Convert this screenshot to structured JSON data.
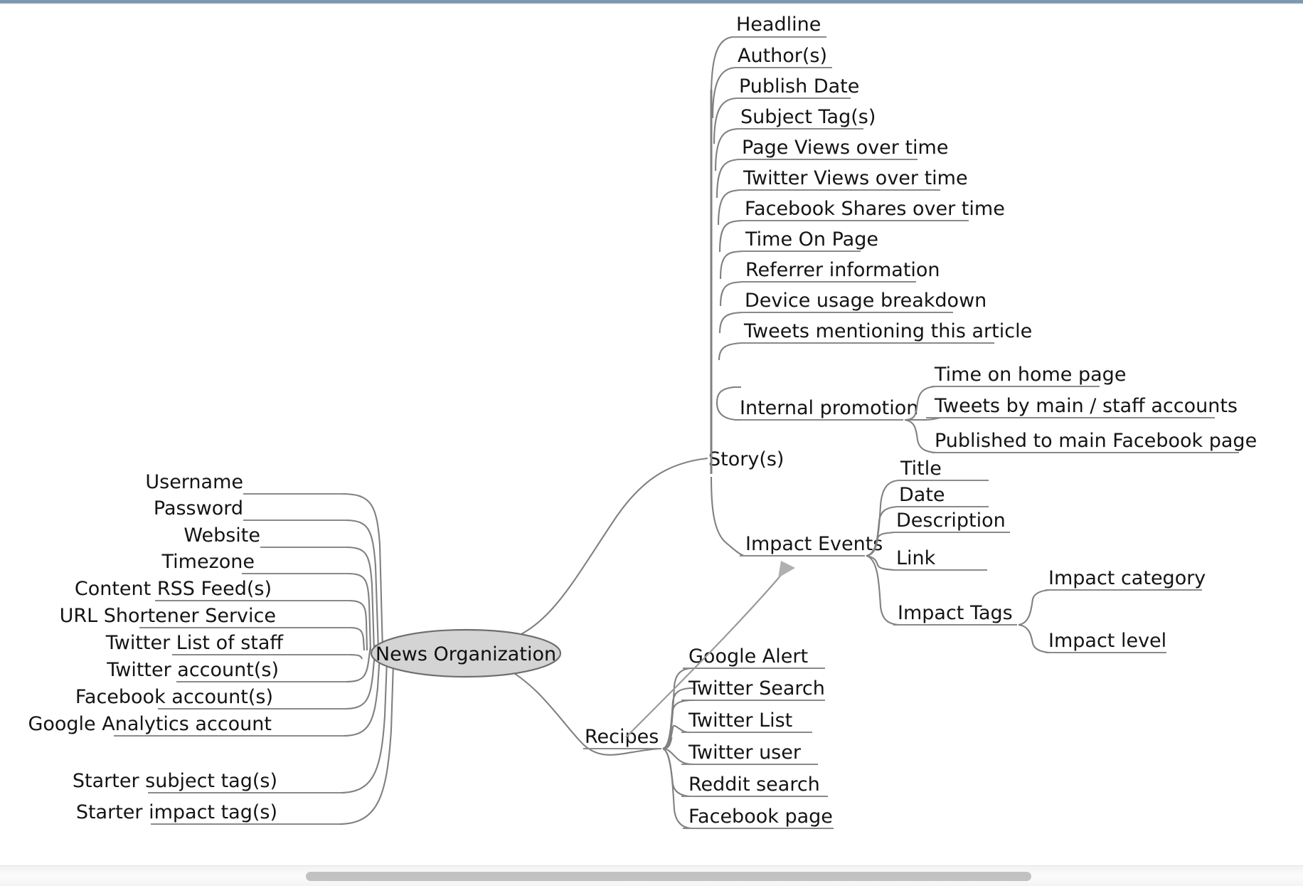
{
  "document": {
    "type": "mind-map",
    "root": "News Organization"
  },
  "window": {
    "titlebar_color": "#7d99b0",
    "scrollbar_thumb_color": "#c2c2c2"
  },
  "colors": {
    "root_fill": "#d4d4d4",
    "root_stroke": "#6e6e6e",
    "branch_stroke": "#808080",
    "text": "#141414",
    "relation_arrow": "#a6a6a6"
  },
  "root": {
    "label": "News Organization"
  },
  "branches": {
    "attributes": {
      "label": "",
      "items": [
        {
          "label": "Username"
        },
        {
          "label": "Password"
        },
        {
          "label": "Website"
        },
        {
          "label": "Timezone"
        },
        {
          "label": "Content RSS Feed(s)"
        },
        {
          "label": "URL Shortener Service"
        },
        {
          "label": "Twitter List of staff"
        },
        {
          "label": "Twitter account(s)"
        },
        {
          "label": "Facebook account(s)"
        },
        {
          "label": "Google Analytics account"
        },
        {
          "label": "Starter subject tag(s)"
        },
        {
          "label": "Starter impact tag(s)"
        }
      ]
    },
    "stories": {
      "label": "Story(s)",
      "items": [
        {
          "label": "Headline"
        },
        {
          "label": "Author(s)"
        },
        {
          "label": "Publish Date"
        },
        {
          "label": "Subject Tag(s)"
        },
        {
          "label": "Page Views over time"
        },
        {
          "label": "Twitter Views over time"
        },
        {
          "label": "Facebook Shares over time"
        },
        {
          "label": "Time On Page"
        },
        {
          "label": "Referrer information"
        },
        {
          "label": "Device usage breakdown"
        },
        {
          "label": "Tweets mentioning this article"
        }
      ],
      "internal_promotion": {
        "label": "Internal promotion",
        "items": [
          {
            "label": "Time on home page"
          },
          {
            "label": "Tweets by main / staff accounts"
          },
          {
            "label": "Published to main Facebook page"
          }
        ]
      }
    },
    "impact_events": {
      "label": "Impact Events",
      "items": [
        {
          "label": "Title"
        },
        {
          "label": "Date"
        },
        {
          "label": "Description"
        },
        {
          "label": "Link"
        }
      ],
      "impact_tags": {
        "label": "Impact Tags",
        "items": [
          {
            "label": "Impact category"
          },
          {
            "label": "Impact level"
          }
        ]
      }
    },
    "recipes": {
      "label": "Recipes",
      "items": [
        {
          "label": "Google Alert"
        },
        {
          "label": "Twitter Search"
        },
        {
          "label": "Twitter List"
        },
        {
          "label": "Twitter user"
        },
        {
          "label": "Reddit search"
        },
        {
          "label": "Facebook page"
        }
      ]
    }
  },
  "relationships": [
    {
      "from": "Recipes",
      "to": "Impact Events",
      "style": "arrow"
    }
  ]
}
